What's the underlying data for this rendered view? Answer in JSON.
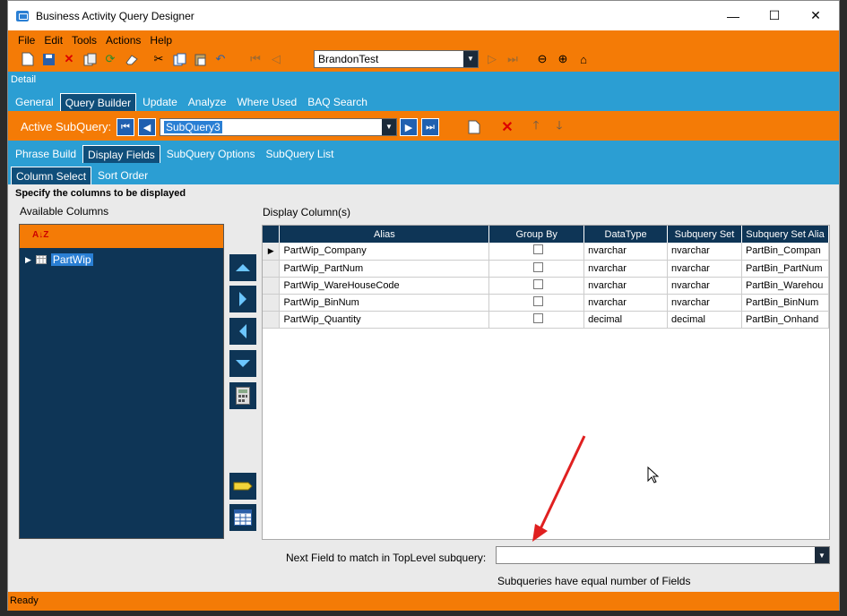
{
  "window": {
    "title": "Business Activity Query Designer",
    "min": "—",
    "max": "☐",
    "close": "✕"
  },
  "menu": [
    "File",
    "Edit",
    "Tools",
    "Actions",
    "Help"
  ],
  "toolbar": {
    "query_combo": "BrandonTest"
  },
  "detail_label": "Detail",
  "tabs_main": [
    "General",
    "Query Builder",
    "Update",
    "Analyze",
    "Where Used",
    "BAQ Search"
  ],
  "active_subquery": {
    "label": "Active SubQuery:",
    "value": "SubQuery3"
  },
  "tabs_sub": [
    "Phrase Build",
    "Display Fields",
    "SubQuery Options",
    "SubQuery List"
  ],
  "tabs_fields": [
    "Column Select",
    "Sort Order"
  ],
  "instruction": "Specify the columns to be displayed",
  "available_label": "Available Columns",
  "display_label": "Display Column(s)",
  "tree": {
    "sort_icon": "A↓Z",
    "node": "PartWip"
  },
  "grid": {
    "headers": [
      "Alias",
      "Group By",
      "DataType",
      "Subquery Set",
      "Subquery Set Alia"
    ],
    "rows": [
      [
        "PartWip_Company",
        "",
        "nvarchar",
        "nvarchar",
        "PartBin_Compan"
      ],
      [
        "PartWip_PartNum",
        "",
        "nvarchar",
        "nvarchar",
        "PartBin_PartNum"
      ],
      [
        "PartWip_WareHouseCode",
        "",
        "nvarchar",
        "nvarchar",
        "PartBin_Warehou"
      ],
      [
        "PartWip_BinNum",
        "",
        "nvarchar",
        "nvarchar",
        "PartBin_BinNum"
      ],
      [
        "PartWip_Quantity",
        "",
        "decimal",
        "decimal",
        "PartBin_Onhand"
      ]
    ]
  },
  "next_field": {
    "label": "Next Field to match in TopLevel subquery:",
    "value": ""
  },
  "equal_msg": "Subqueries have equal number of Fields",
  "status": "Ready",
  "colors": {
    "orange": "#f47b06",
    "blue": "#2b9ed3",
    "navy": "#0e3556"
  }
}
